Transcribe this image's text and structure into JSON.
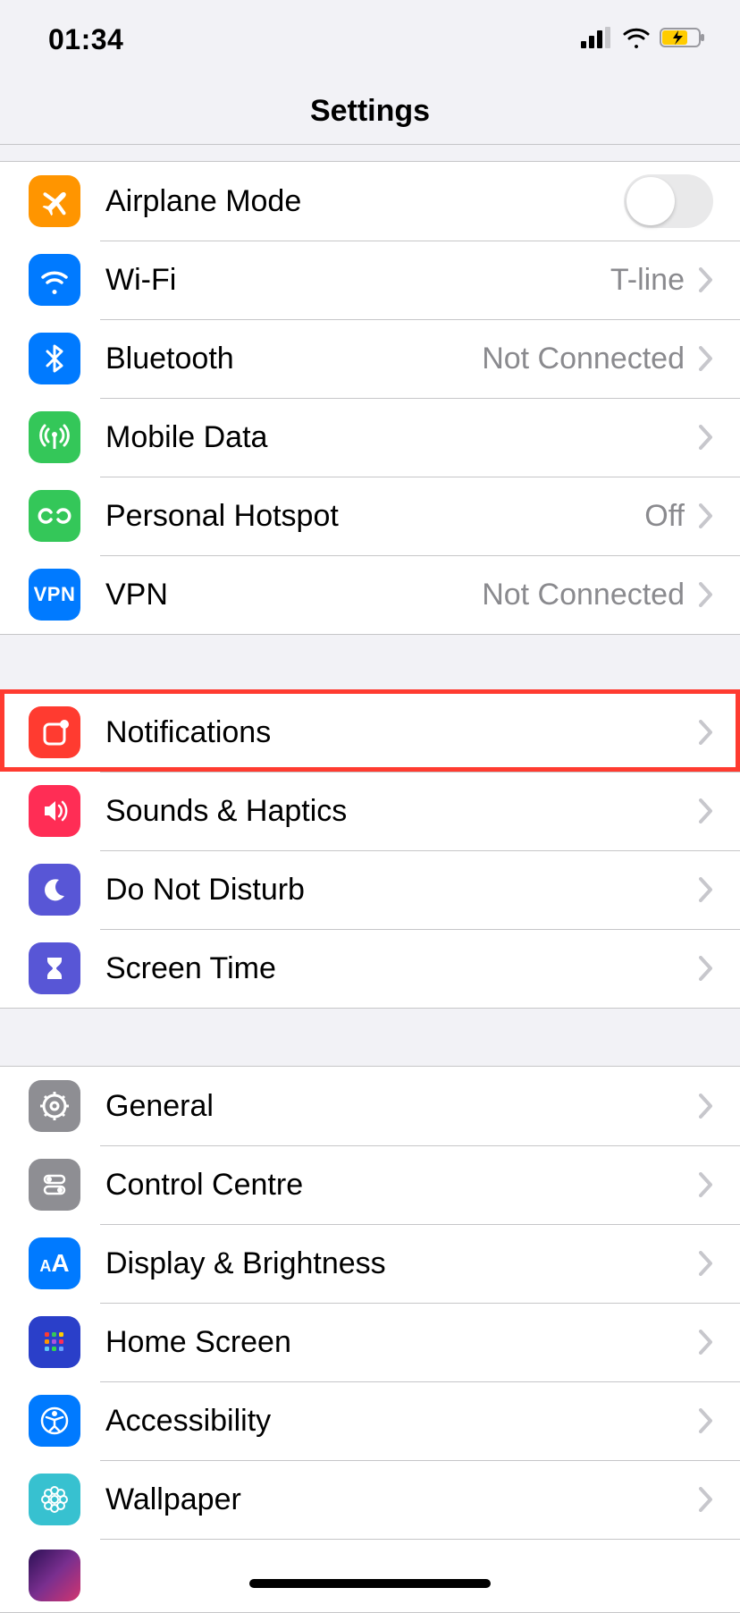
{
  "status": {
    "time": "01:34"
  },
  "header": {
    "title": "Settings"
  },
  "groups": [
    {
      "rows": [
        {
          "key": "airplane",
          "label": "Airplane Mode",
          "value": "",
          "control": "toggle",
          "toggle_on": false,
          "icon": "airplane-icon",
          "bg": "#ff9500"
        },
        {
          "key": "wifi",
          "label": "Wi-Fi",
          "value": "T-line",
          "control": "disclosure",
          "icon": "wifi-icon",
          "bg": "#007aff"
        },
        {
          "key": "bluetooth",
          "label": "Bluetooth",
          "value": "Not Connected",
          "control": "disclosure",
          "icon": "bluetooth-icon",
          "bg": "#007aff"
        },
        {
          "key": "mobiledata",
          "label": "Mobile Data",
          "value": "",
          "control": "disclosure",
          "icon": "antenna-icon",
          "bg": "#34c759"
        },
        {
          "key": "hotspot",
          "label": "Personal Hotspot",
          "value": "Off",
          "control": "disclosure",
          "icon": "link-icon",
          "bg": "#34c759"
        },
        {
          "key": "vpn",
          "label": "VPN",
          "value": "Not Connected",
          "control": "disclosure",
          "icon": "vpn-icon",
          "bg": "#007aff"
        }
      ]
    },
    {
      "rows": [
        {
          "key": "notifications",
          "label": "Notifications",
          "value": "",
          "control": "disclosure",
          "icon": "notifications-icon",
          "bg": "#ff3b30",
          "highlighted": true
        },
        {
          "key": "sounds",
          "label": "Sounds & Haptics",
          "value": "",
          "control": "disclosure",
          "icon": "speaker-icon",
          "bg": "#ff2d55"
        },
        {
          "key": "dnd",
          "label": "Do Not Disturb",
          "value": "",
          "control": "disclosure",
          "icon": "moon-icon",
          "bg": "#5856d6"
        },
        {
          "key": "screentime",
          "label": "Screen Time",
          "value": "",
          "control": "disclosure",
          "icon": "hourglass-icon",
          "bg": "#5856d6"
        }
      ]
    },
    {
      "rows": [
        {
          "key": "general",
          "label": "General",
          "value": "",
          "control": "disclosure",
          "icon": "gear-icon",
          "bg": "#8e8e93"
        },
        {
          "key": "controlcentre",
          "label": "Control Centre",
          "value": "",
          "control": "disclosure",
          "icon": "switches-icon",
          "bg": "#8e8e93"
        },
        {
          "key": "display",
          "label": "Display & Brightness",
          "value": "",
          "control": "disclosure",
          "icon": "aa-icon",
          "bg": "#007aff"
        },
        {
          "key": "homescreen",
          "label": "Home Screen",
          "value": "",
          "control": "disclosure",
          "icon": "grid-icon",
          "bg": "#3355dd"
        },
        {
          "key": "accessibility",
          "label": "Accessibility",
          "value": "",
          "control": "disclosure",
          "icon": "accessibility-icon",
          "bg": "#007aff"
        },
        {
          "key": "wallpaper",
          "label": "Wallpaper",
          "value": "",
          "control": "disclosure",
          "icon": "flower-icon",
          "bg": "#37c1d0"
        }
      ]
    }
  ]
}
